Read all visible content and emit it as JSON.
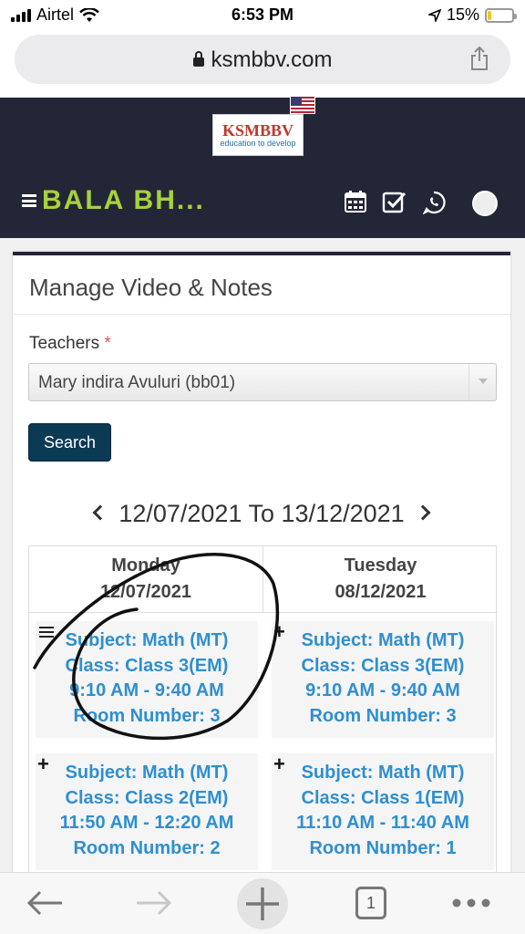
{
  "status": {
    "carrier": "Airtel",
    "time": "6:53 PM",
    "battery": "15%",
    "battery_level": 0.15
  },
  "browser": {
    "url": "ksmbbv.com",
    "tab_count": "1"
  },
  "header": {
    "logo_text": "KSMBBV",
    "logo_tagline": "education to develop",
    "brand": "BALA BH...",
    "icons": [
      "menu-icon",
      "us-flag-icon",
      "calendar-icon",
      "checkbox-icon",
      "whatsapp-icon",
      "profile-avatar"
    ]
  },
  "card": {
    "title": "Manage Video & Notes",
    "teachers_label": "Teachers",
    "required_mark": "*",
    "teacher_selected": "Mary indira Avuluri (bb01)",
    "search_label": "Search",
    "range_start": "12/07/2021",
    "range_sep": "To",
    "range_end": "13/12/2021"
  },
  "days": [
    {
      "name": "Monday",
      "date": "12/07/2021"
    },
    {
      "name": "Tuesday",
      "date": "08/12/2021"
    }
  ],
  "slots": [
    {
      "subject": "Subject: Math (MT)",
      "class": "Class: Class 3(EM)",
      "time": "9:10 AM - 9:40 AM",
      "room": "Room Number: 3"
    },
    {
      "subject": "Subject: Math (MT)",
      "class": "Class: Class 3(EM)",
      "time": "9:10 AM - 9:40 AM",
      "room": "Room Number: 3"
    },
    {
      "subject": "Subject: Math (MT)",
      "class": "Class: Class 2(EM)",
      "time": "11:50 AM - 12:20 AM",
      "room": "Room Number: 2"
    },
    {
      "subject": "Subject: Math (MT)",
      "class": "Class: Class 1(EM)",
      "time": "11:10 AM - 11:40 AM",
      "room": "Room Number: 1"
    }
  ],
  "colors": {
    "header_bg": "#232636",
    "brand_green": "#a8d13b",
    "slot_text": "#2f8fd0",
    "search_btn": "#0b3a55"
  }
}
